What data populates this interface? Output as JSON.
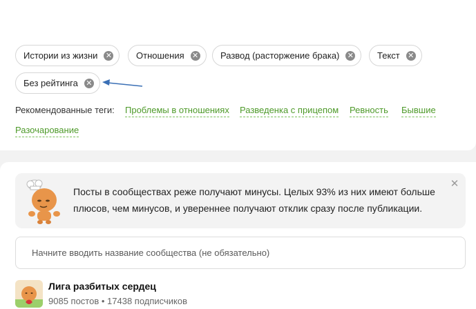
{
  "selected_tags": [
    {
      "label": "Истории из жизни"
    },
    {
      "label": "Отношения"
    },
    {
      "label": "Развод (расторжение брака)"
    },
    {
      "label": "Текст"
    },
    {
      "label": "Без рейтинга"
    }
  ],
  "recommended": {
    "label": "Рекомендованные теги:",
    "tags": [
      "Проблемы в отношениях",
      "Разведенка с прицепом",
      "Ревность",
      "Бывшие",
      "Разочарование"
    ]
  },
  "info": {
    "text": "Посты в сообществах реже получают минусы. Целых 93% из них имеют больше плюсов, чем минусов, и увереннее получают отклик сразу после публикации."
  },
  "community_search": {
    "placeholder": "Начните вводить название сообщества (не обязательно)"
  },
  "community": {
    "name": "Лига разбитых сердец",
    "stats": "9085 постов • 17438 подписчиков"
  },
  "colors": {
    "accent_green": "#4e9a2a",
    "arrow_blue": "#3a6fb5"
  }
}
